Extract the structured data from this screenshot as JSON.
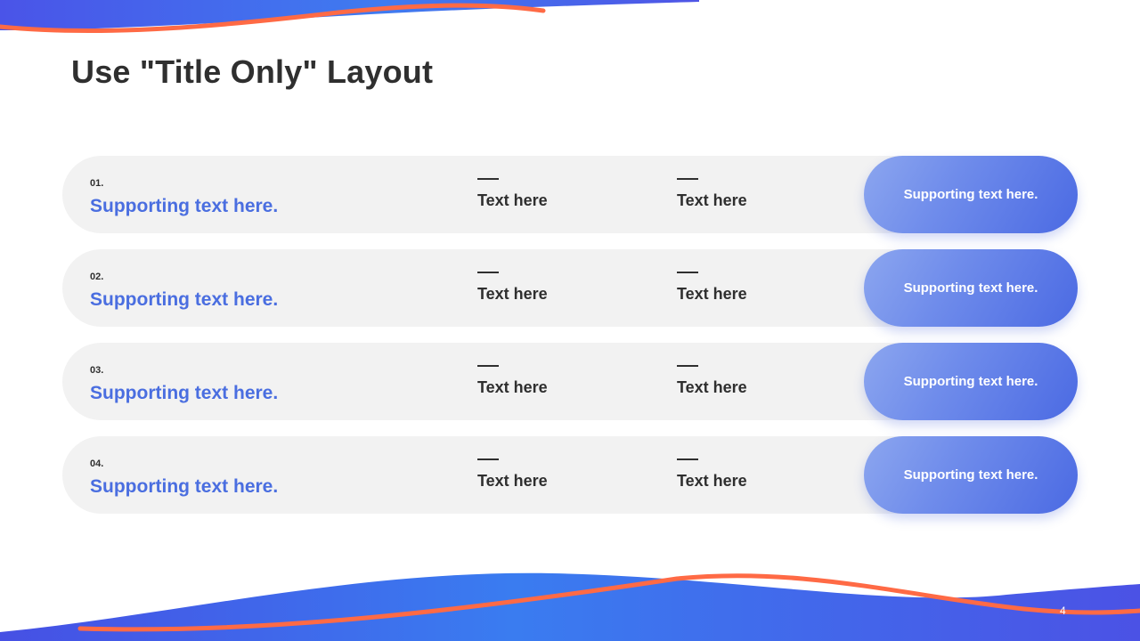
{
  "slide": {
    "title": "Use \"Title Only\" Layout",
    "page_number": "4"
  },
  "colors": {
    "accent_blue": "#4a6ee0",
    "orange": "#ff6a45",
    "dark_text": "#2f2f2f",
    "row_bg": "#f2f2f2"
  },
  "rows": [
    {
      "num": "01.",
      "title": "Supporting text here.",
      "col_a": "Text here",
      "col_b": "Text here",
      "pill": "Supporting text here."
    },
    {
      "num": "02.",
      "title": "Supporting text here.",
      "col_a": "Text here",
      "col_b": "Text here",
      "pill": "Supporting text here."
    },
    {
      "num": "03.",
      "title": "Supporting text here.",
      "col_a": "Text here",
      "col_b": "Text here",
      "pill": "Supporting text here."
    },
    {
      "num": "04.",
      "title": "Supporting text here.",
      "col_a": "Text here",
      "col_b": "Text here",
      "pill": "Supporting text here."
    }
  ]
}
